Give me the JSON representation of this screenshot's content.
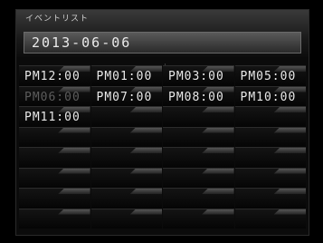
{
  "header": {
    "title": "イベントリスト",
    "date": "2013-06-06"
  },
  "events": [
    {
      "label": "PM12:00",
      "dim": false
    },
    {
      "label": "PM01:00",
      "dim": false
    },
    {
      "label": "PM03:00",
      "dim": false
    },
    {
      "label": "PM05:00",
      "dim": false
    },
    {
      "label": "PM06:00",
      "dim": true
    },
    {
      "label": "PM07:00",
      "dim": false
    },
    {
      "label": "PM08:00",
      "dim": false
    },
    {
      "label": "PM10:00",
      "dim": false
    },
    {
      "label": "PM11:00",
      "dim": false
    }
  ]
}
